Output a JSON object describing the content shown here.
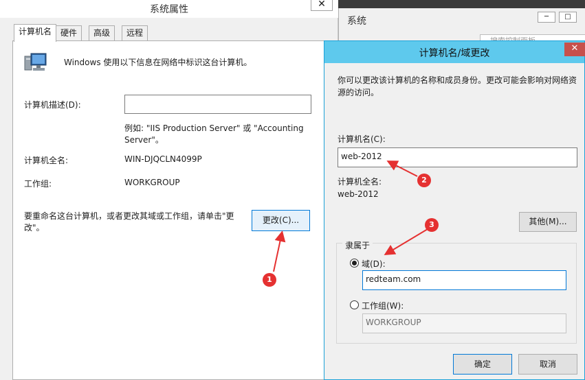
{
  "system_properties": {
    "title": "系统属性",
    "close": "✕",
    "tabs": [
      "计算机名",
      "硬件",
      "高级",
      "远程"
    ],
    "intro": "Windows 使用以下信息在网络中标识这台计算机。",
    "description_label": "计算机描述(D):",
    "description_value": "",
    "example_line1": "例如: \"IIS Production Server\" 或 \"Accounting",
    "example_line2": "Server\"。",
    "full_name_label": "计算机全名:",
    "full_name_value": "WIN-DJQCLN4099P",
    "workgroup_label": "工作组:",
    "workgroup_value": "WORKGROUP",
    "rename_line1": "要重命名这台计算机，或者更改其域或工作组，请单击\"更",
    "rename_line2": "改\"。",
    "change_button": "更改(C)..."
  },
  "system_window": {
    "title": "系统",
    "search_placeholder": "搜索控制面板"
  },
  "change_dialog": {
    "title": "计算机名/域更改",
    "close": "✕",
    "intro_line1": "你可以更改该计算机的名称和成员身份。更改可能会影响对网络资",
    "intro_line2": "源的访问。",
    "name_label": "计算机名(C):",
    "name_value": "web-2012",
    "full_name_label": "计算机全名:",
    "full_name_value": "web-2012",
    "more_button": "其他(M)...",
    "member_of_label": "隶属于",
    "domain_label": "域(D):",
    "domain_value": "redteam.com",
    "workgroup_label": "工作组(W):",
    "workgroup_value": "WORKGROUP",
    "ok_button": "确定",
    "cancel_button": "取消"
  },
  "annotations": {
    "badges": [
      "1",
      "2",
      "3"
    ],
    "color": "#e53131"
  }
}
